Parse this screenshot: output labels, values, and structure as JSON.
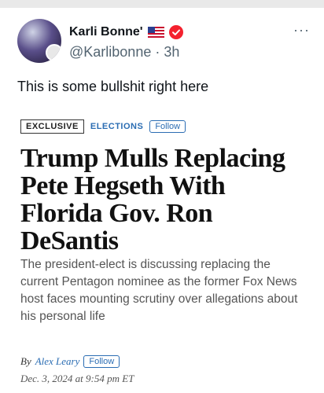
{
  "tweet": {
    "display_name": "Karli Bonne'",
    "handle_time": "@Karlibonne · 3h",
    "body": "This is some bullshit right here",
    "more_label": "···"
  },
  "article": {
    "tag_exclusive": "EXCLUSIVE",
    "tag_section": "ELECTIONS",
    "follow_label": "Follow",
    "headline": "Trump Mulls Replacing Pete Hegseth With Florida Gov. Ron DeSantis",
    "dek": "The president-elect is discussing replacing the current Pentagon nominee as the former Fox News host faces mounting scrutiny over allegations about his personal life",
    "byline_prefix": "By",
    "author": "Alex Leary",
    "author_follow_label": "Follow",
    "dateline": "Dec. 3, 2024 at 9:54 pm ET"
  },
  "colors": {
    "accent": "#2b6db3",
    "verified": "#f4212e",
    "muted": "#536471"
  },
  "icons": {
    "flag": "us-flag-icon",
    "verified": "verified-check-icon",
    "more": "more-options-icon"
  }
}
